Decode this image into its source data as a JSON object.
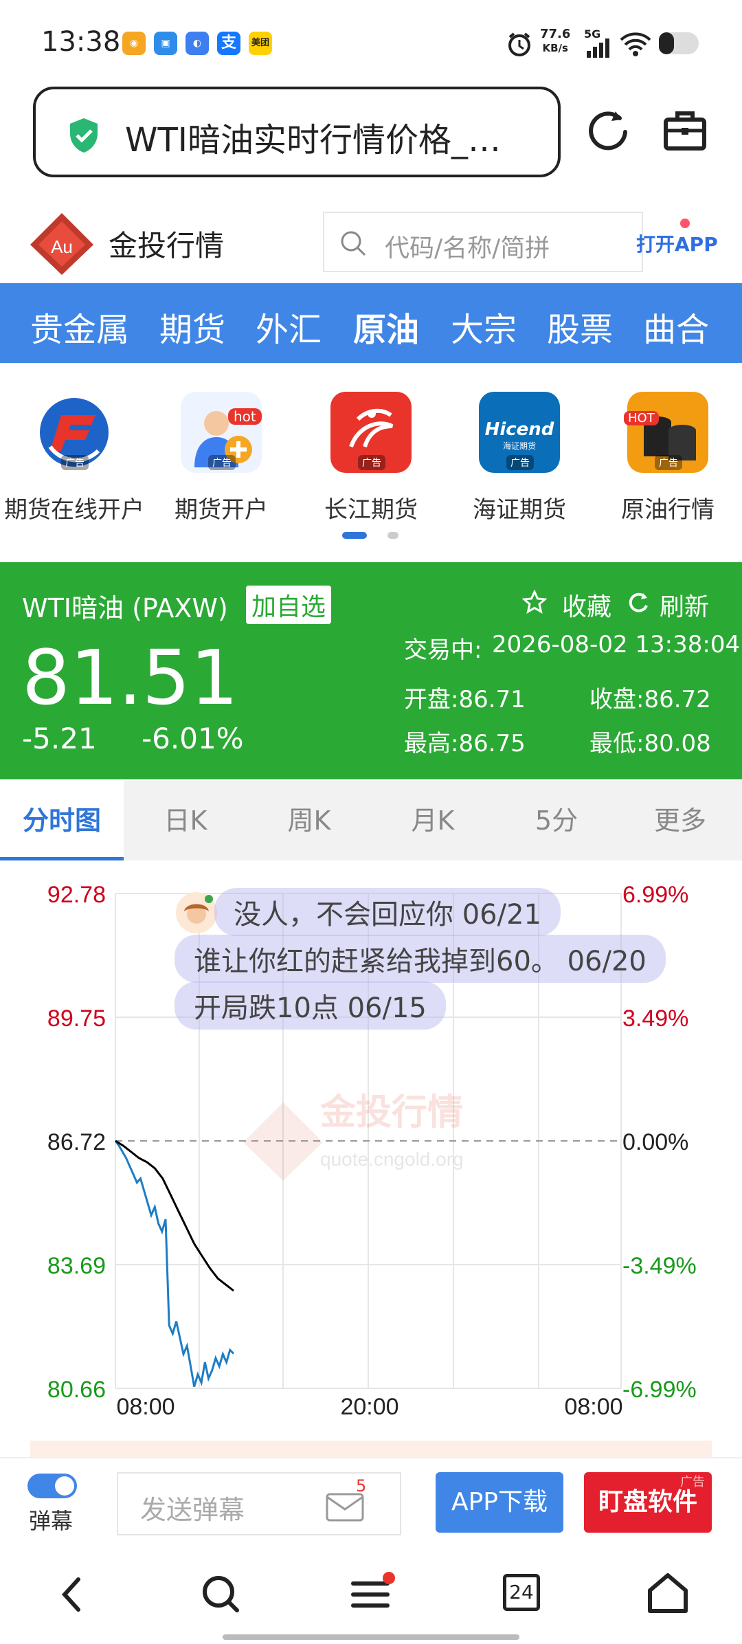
{
  "status_bar": {
    "time": "13:38",
    "speed_value": "77.6",
    "speed_unit": "KB/s",
    "network": "5G",
    "app_icons": [
      "weibo-icon",
      "cloud-icon",
      "browser-icon",
      "alipay-icon",
      "meituan-icon"
    ],
    "meituan_label": "美团",
    "alipay_label": "支"
  },
  "address_bar": {
    "title": "WTI暗油实时行情价格_…"
  },
  "site_header": {
    "brand": "金投行情",
    "logo_text": "Au",
    "search_placeholder": "代码/名称/简拼",
    "open_app": "打开APP"
  },
  "nav": {
    "items": [
      "贵金属",
      "期货",
      "外汇",
      "原油",
      "大宗",
      "股票",
      "曲合"
    ],
    "accent": "#3f86e7"
  },
  "ads": {
    "items": [
      {
        "label": "期货在线开户",
        "tag": "广告"
      },
      {
        "label": "期货开户",
        "tag": "广告",
        "badge": "hot"
      },
      {
        "label": "长江期货",
        "tag": "广告"
      },
      {
        "label": "海证期货",
        "tag": "广告",
        "icon_text": "Hicend",
        "icon_subtext": "海证期货"
      },
      {
        "label": "原油行情",
        "tag": "广告",
        "badge": "HOT"
      }
    ]
  },
  "quote": {
    "name": "WTI暗油 (PAXW)",
    "add_favorite": "加自选",
    "collect": "收藏",
    "refresh": "刷新",
    "status": "交易中:",
    "datetime": "2026-08-02 13:38:04",
    "price": "81.51",
    "change": "-5.21",
    "change_pct": "-6.01%",
    "open": "开盘:86.71",
    "close": "收盘:86.72",
    "high": "最高:86.75",
    "low": "最低:80.08",
    "color": "#2ba935"
  },
  "tabs": {
    "items": [
      "分时图",
      "日K",
      "周K",
      "月K",
      "5分",
      "更多"
    ],
    "active": 0
  },
  "chart_data": {
    "type": "line",
    "y_labels_left": [
      "92.78",
      "89.75",
      "86.72",
      "83.69",
      "80.66"
    ],
    "y_labels_right": [
      "6.99%",
      "3.49%",
      "0.00%",
      "-3.49%",
      "-6.99%"
    ],
    "x_labels": [
      "08:00",
      "20:00",
      "08:00"
    ],
    "ylim": [
      80.66,
      92.78
    ],
    "reference": 86.72,
    "watermark": "金投行情",
    "watermark_url": "quote.cngold.org",
    "series": [
      {
        "values": [
          86.72,
          86.6,
          86.45,
          86.3,
          86.1,
          85.9,
          85.7,
          85.8,
          85.5,
          85.2,
          84.9,
          85.1,
          84.7,
          84.5,
          84.8,
          82.2,
          82.0,
          82.3,
          81.9,
          81.5,
          81.7,
          81.2,
          80.7,
          81.0,
          80.8,
          81.3,
          80.9,
          81.1,
          81.4,
          81.2,
          81.5,
          81.3,
          81.6,
          81.51
        ],
        "color": "#1c7dc4"
      },
      {
        "values": [
          86.72,
          86.6,
          86.45,
          86.3,
          86.2,
          86.05,
          85.8,
          85.4,
          85.0,
          84.6,
          84.2,
          83.9,
          83.6,
          83.35,
          83.2,
          83.05
        ],
        "color": "#000000"
      }
    ]
  },
  "danmu": {
    "items": [
      {
        "text": "没人，不会回应你 06/21"
      },
      {
        "text": "谁让你红的赶紧给我掉到60。 06/20"
      },
      {
        "text": "开局跌10点 06/15"
      }
    ]
  },
  "bottom_bar": {
    "danmu_label": "弹幕",
    "send_placeholder": "发送弹幕",
    "mail_count": "5",
    "app_download": "APP下载",
    "watch_software": "盯盘软件",
    "ad_tag": "广告"
  },
  "system_nav": {
    "tabs_count": "24"
  }
}
